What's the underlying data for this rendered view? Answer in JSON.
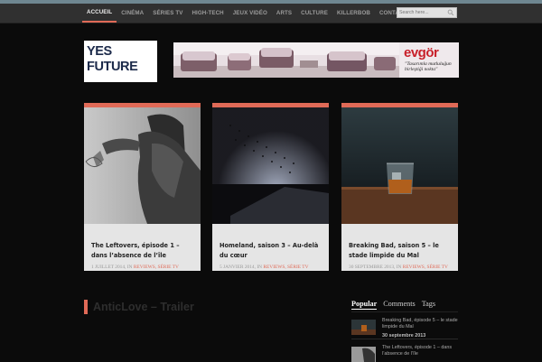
{
  "nav": {
    "items": [
      "Accueil",
      "Cinéma",
      "Séries TV",
      "High-Tech",
      "Jeux vidéo",
      "Arts",
      "Culture",
      "Killerbob",
      "Contact"
    ],
    "active_index": 0
  },
  "search": {
    "placeholder": "Search here..."
  },
  "logo": {
    "line1": "YES",
    "line2": "FUTURE"
  },
  "banner": {
    "brand": "evgör",
    "tagline": "\"Tasarımla mutluluğun birleştiği nokta\""
  },
  "cards": [
    {
      "title": "The Leftovers, épisode 1 – dans l’absence de l’île",
      "date": "1 juillet 2014",
      "in": "in",
      "categories": "Reviews, Série TV"
    },
    {
      "title": "Homeland, saison 3 – Au-delà du cœur",
      "date": "5 janvier 2014",
      "in": "in",
      "categories": "Reviews, Série TV"
    },
    {
      "title": "Breaking Bad, saison 5 – le stade limpide du Mal",
      "date": "30 septembre 2013",
      "in": "in",
      "categories": "Reviews, Série TV"
    }
  ],
  "section": {
    "title": "AnticLove – Trailer"
  },
  "sidebar": {
    "tabs": [
      "Popular",
      "Comments",
      "Tags"
    ],
    "active_tab": 0,
    "popular": [
      {
        "title": "Breaking Bad, épisode 5 – le stade limpide du Mal",
        "date": "30 septembre 2013"
      },
      {
        "title": "The Leftovers, épisode 1 – dans l’absence de l’île",
        "date": ""
      }
    ]
  },
  "colors": {
    "accent": "#e06a57",
    "navbar": "#303030",
    "background": "#0b0b0b",
    "card": "#e5e5e5"
  }
}
